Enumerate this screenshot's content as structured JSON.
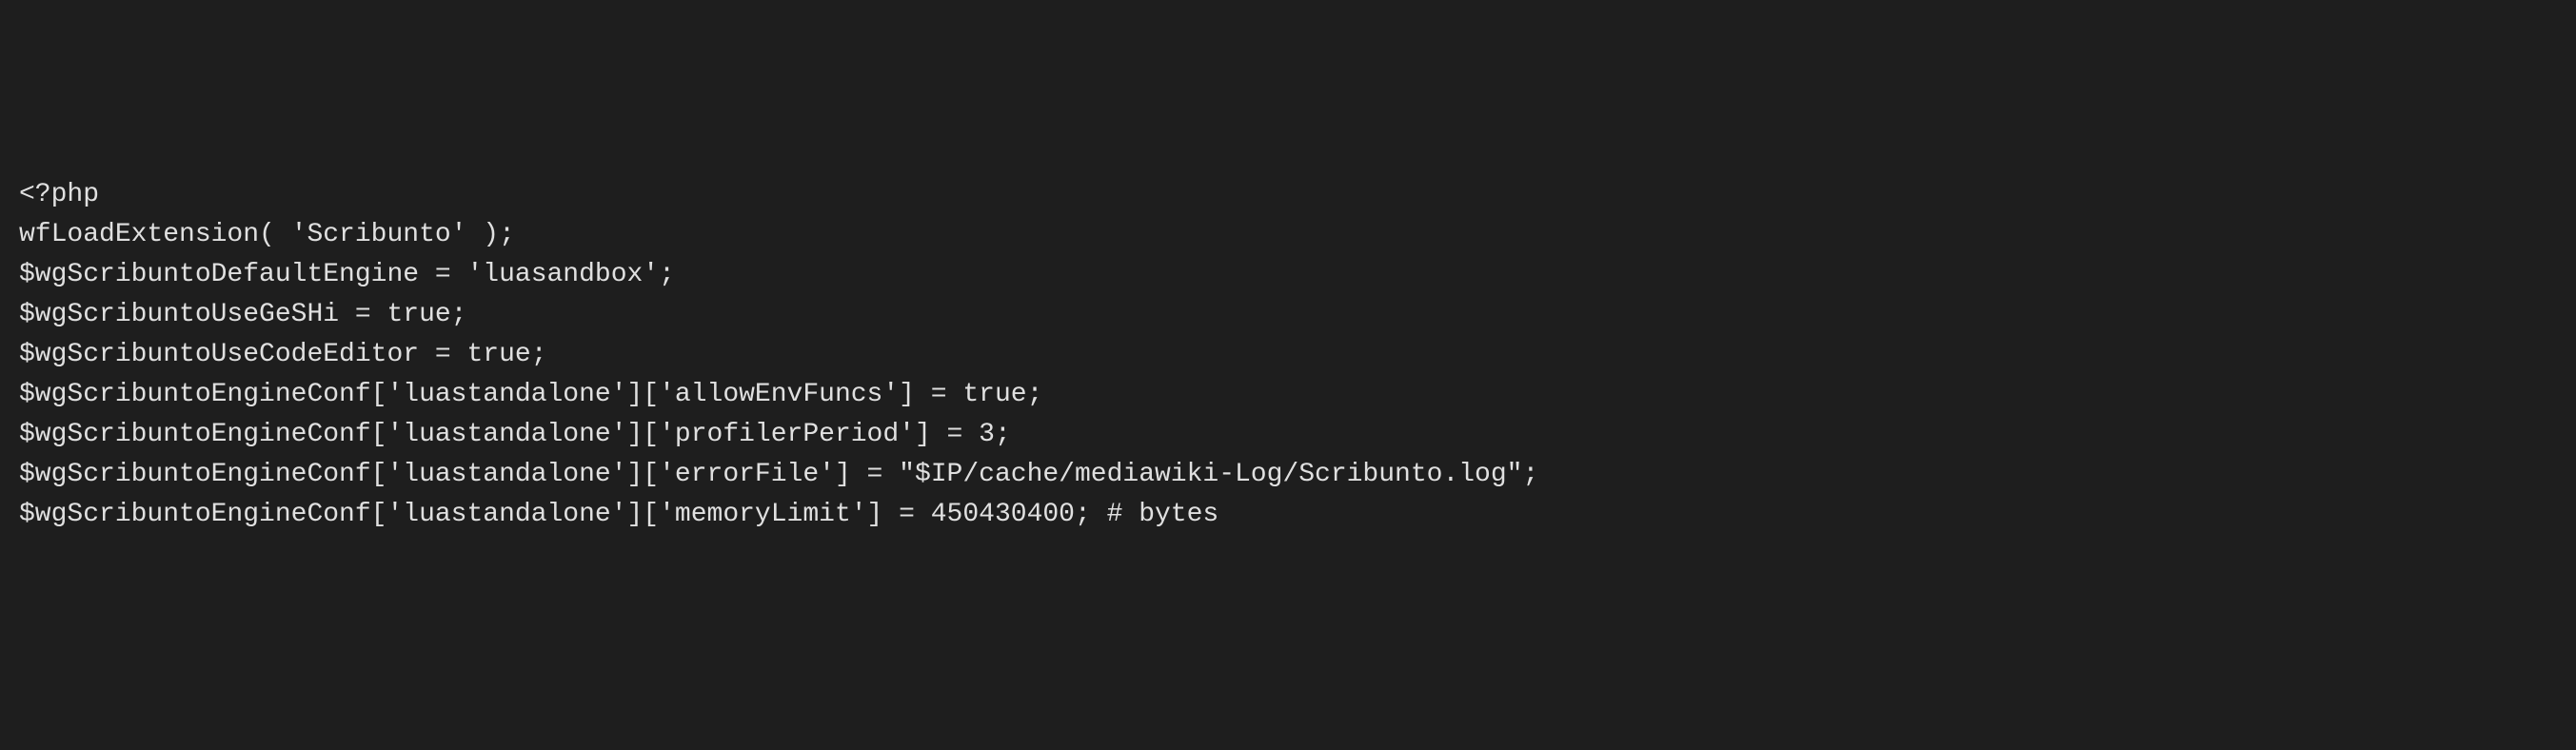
{
  "code": {
    "lines": [
      "<?php",
      "wfLoadExtension( 'Scribunto' );",
      "$wgScribuntoDefaultEngine = 'luasandbox';",
      "$wgScribuntoUseGeSHi = true;",
      "$wgScribuntoUseCodeEditor = true;",
      "$wgScribuntoEngineConf['luastandalone']['allowEnvFuncs'] = true;",
      "$wgScribuntoEngineConf['luastandalone']['profilerPeriod'] = 3;",
      "$wgScribuntoEngineConf['luastandalone']['errorFile'] = \"$IP/cache/mediawiki-Log/Scribunto.log\";",
      "$wgScribuntoEngineConf['luastandalone']['memoryLimit'] = 450430400; # bytes"
    ]
  }
}
